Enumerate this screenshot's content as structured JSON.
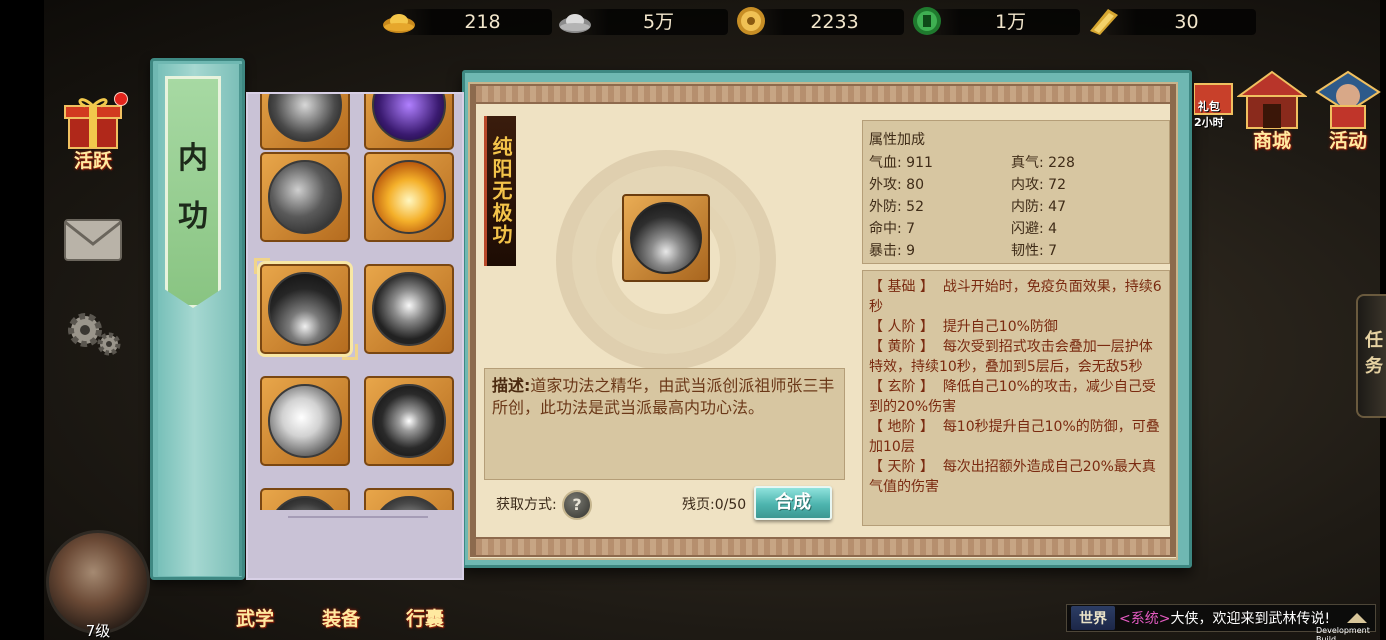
{
  "currencies": [
    {
      "icon": "gold-ingot-icon",
      "value": "218"
    },
    {
      "icon": "silver-ingot-icon",
      "value": "5万"
    },
    {
      "icon": "coin-icon",
      "value": "2233"
    },
    {
      "icon": "jade-token-icon",
      "value": "1万"
    },
    {
      "icon": "ticket-icon",
      "value": "30"
    }
  ],
  "left_rail": {
    "active_label": "活跃",
    "mail_icon": "mail-icon",
    "settings_icon": "gear-icon"
  },
  "book": {
    "category": "内 功"
  },
  "skill_detail": {
    "name": "纯阳无极功",
    "description_label": "描述:",
    "description": "道家功法之精华，由武当派创派祖师张三丰所创，此功法是武当派最高内功心法。",
    "obtain_label": "获取方式:",
    "help_glyph": "?",
    "fragments": "残页:0/50",
    "synth_label": "合成"
  },
  "attributes": {
    "title": "属性加成",
    "items": [
      {
        "label": "气血:",
        "value": "911"
      },
      {
        "label": "真气:",
        "value": "228"
      },
      {
        "label": "外攻:",
        "value": "80"
      },
      {
        "label": "内攻:",
        "value": "72"
      },
      {
        "label": "外防:",
        "value": "52"
      },
      {
        "label": "内防:",
        "value": "47"
      },
      {
        "label": "命中:",
        "value": "7"
      },
      {
        "label": "闪避:",
        "value": "4"
      },
      {
        "label": "暴击:",
        "value": "9"
      },
      {
        "label": "韧性:",
        "value": "7"
      }
    ]
  },
  "tiers": [
    {
      "tag": "【 基础 】",
      "text": "战斗开始时，免疫负面效果，持续6秒"
    },
    {
      "tag": "【 人阶 】",
      "text": "提升自己10%防御"
    },
    {
      "tag": "【 黄阶 】",
      "text": "每次受到招式攻击会叠加一层护体特效，持续10秒，叠加到5层后，会无敌5秒"
    },
    {
      "tag": "【 玄阶 】",
      "text": "降低自己10%的攻击，减少自己受到的20%伤害"
    },
    {
      "tag": "【 地阶 】",
      "text": "每10秒提升自己10%的防御，可叠加10层"
    },
    {
      "tag": "【 天阶 】",
      "text": "每次出招额外造成自己20%最大真气值的伤害"
    }
  ],
  "right_icons": [
    {
      "label": "2小时",
      "sub": "礼包",
      "icon": "gift-pack-icon"
    },
    {
      "label": "商城",
      "icon": "shop-icon"
    },
    {
      "label": "活动",
      "icon": "event-icon"
    }
  ],
  "mission_tab": "任务",
  "player": {
    "level": "7级"
  },
  "bottom_tabs": [
    "武学",
    "装备",
    "行囊"
  ],
  "chat": {
    "channel": "世界",
    "sender": "<系统>",
    "message": "大侠，欢迎来到武林传说!"
  },
  "dev_build": "Development Build"
}
